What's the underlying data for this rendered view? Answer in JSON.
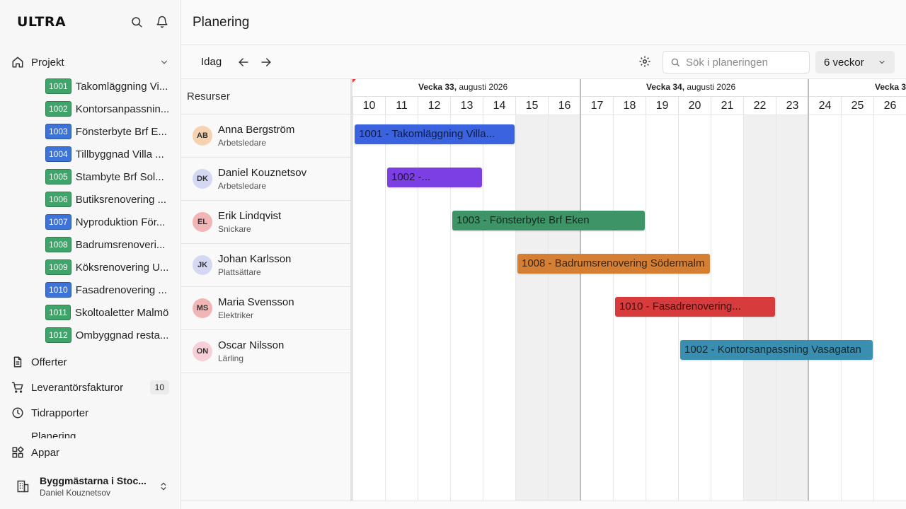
{
  "app": {
    "logo": "ULTRA"
  },
  "sidebar": {
    "projects_label": "Projekt",
    "projects": [
      {
        "num": "1001",
        "name": "Takomläggning Vi...",
        "color": "#3fa46a"
      },
      {
        "num": "1002",
        "name": "Kontorsanpassnin...",
        "color": "#3fa46a"
      },
      {
        "num": "1003",
        "name": "Fönsterbyte Brf E...",
        "color": "#3b73d6"
      },
      {
        "num": "1004",
        "name": "Tillbyggnad Villa ...",
        "color": "#3b73d6"
      },
      {
        "num": "1005",
        "name": "Stambyte Brf Sol...",
        "color": "#3fa46a"
      },
      {
        "num": "1006",
        "name": "Butiksrenovering ...",
        "color": "#3fa46a"
      },
      {
        "num": "1007",
        "name": "Nyproduktion För...",
        "color": "#3b73d6"
      },
      {
        "num": "1008",
        "name": "Badrumsrenoveri...",
        "color": "#3fa46a"
      },
      {
        "num": "1009",
        "name": "Köksrenovering U...",
        "color": "#3fa46a"
      },
      {
        "num": "1010",
        "name": "Fasadrenovering ...",
        "color": "#3b73d6"
      },
      {
        "num": "1011",
        "name": "Skoltoaletter Malmö",
        "color": "#3fa46a"
      },
      {
        "num": "1012",
        "name": "Ombyggnad resta...",
        "color": "#3fa46a"
      }
    ],
    "offers_label": "Offerter",
    "invoices_label": "Leverantörsfakturor",
    "invoices_count": "10",
    "time_label": "Tidrapporter",
    "planning_label": "Planering",
    "apps_label": "Appar",
    "org_name": "Byggmästarna i Stoc...",
    "user_name": "Daniel Kouznetsov"
  },
  "header": {
    "title": "Planering"
  },
  "toolbar": {
    "today": "Idag",
    "search_placeholder": "Sök i planeringen",
    "range": "6 veckor"
  },
  "resources": {
    "header": "Resurser",
    "rows": [
      {
        "initials": "AB",
        "name": "Anna Bergström",
        "role": "Arbetsledare",
        "avatar_color": "#f6d3b0"
      },
      {
        "initials": "DK",
        "name": "Daniel Kouznetsov",
        "role": "Arbetsledare",
        "avatar_color": "#d4d8f2"
      },
      {
        "initials": "EL",
        "name": "Erik Lindqvist",
        "role": "Snickare",
        "avatar_color": "#f1b5b5"
      },
      {
        "initials": "JK",
        "name": "Johan Karlsson",
        "role": "Plattsättare",
        "avatar_color": "#d4d8f2"
      },
      {
        "initials": "MS",
        "name": "Maria Svensson",
        "role": "Elektriker",
        "avatar_color": "#f1b5b5"
      },
      {
        "initials": "ON",
        "name": "Oscar Nilsson",
        "role": "Lärling",
        "avatar_color": "#f6d0d6"
      }
    ]
  },
  "timeline": {
    "weeks": [
      {
        "week": "Vecka 33,",
        "month": "augusti 2026"
      },
      {
        "week": "Vecka 34,",
        "month": "augusti 2026"
      },
      {
        "week": "Vecka 3",
        "month": ""
      }
    ],
    "days": [
      "10",
      "11",
      "12",
      "13",
      "14",
      "15",
      "16",
      "17",
      "18",
      "19",
      "20",
      "21",
      "22",
      "23",
      "24",
      "25",
      "26"
    ],
    "weekend_days": [
      "15",
      "16",
      "22",
      "23"
    ],
    "bars": [
      {
        "label": "1001 - Takomläggning Villa...",
        "row": 0,
        "start_day": "10",
        "end_day": "14",
        "color": "#3b63e0"
      },
      {
        "label": "1002 -...",
        "row": 1,
        "start_day": "11",
        "end_day": "13",
        "color": "#7b3fe4"
      },
      {
        "label": "1003 - Fönsterbyte Brf Eken",
        "row": 2,
        "start_day": "13",
        "end_day": "18",
        "color": "#3d9467"
      },
      {
        "label": "1008 - Badrumsrenovering Södermalm",
        "row": 3,
        "start_day": "15",
        "end_day": "20",
        "color": "#d47f33"
      },
      {
        "label": "1010 - Fasadrenovering...",
        "row": 4,
        "start_day": "18",
        "end_day": "22",
        "color": "#d73b3b"
      },
      {
        "label": "1002 - Kontorsanpassning Vasagatan",
        "row": 5,
        "start_day": "20",
        "end_day": "25",
        "color": "#3a8fb0"
      }
    ]
  }
}
